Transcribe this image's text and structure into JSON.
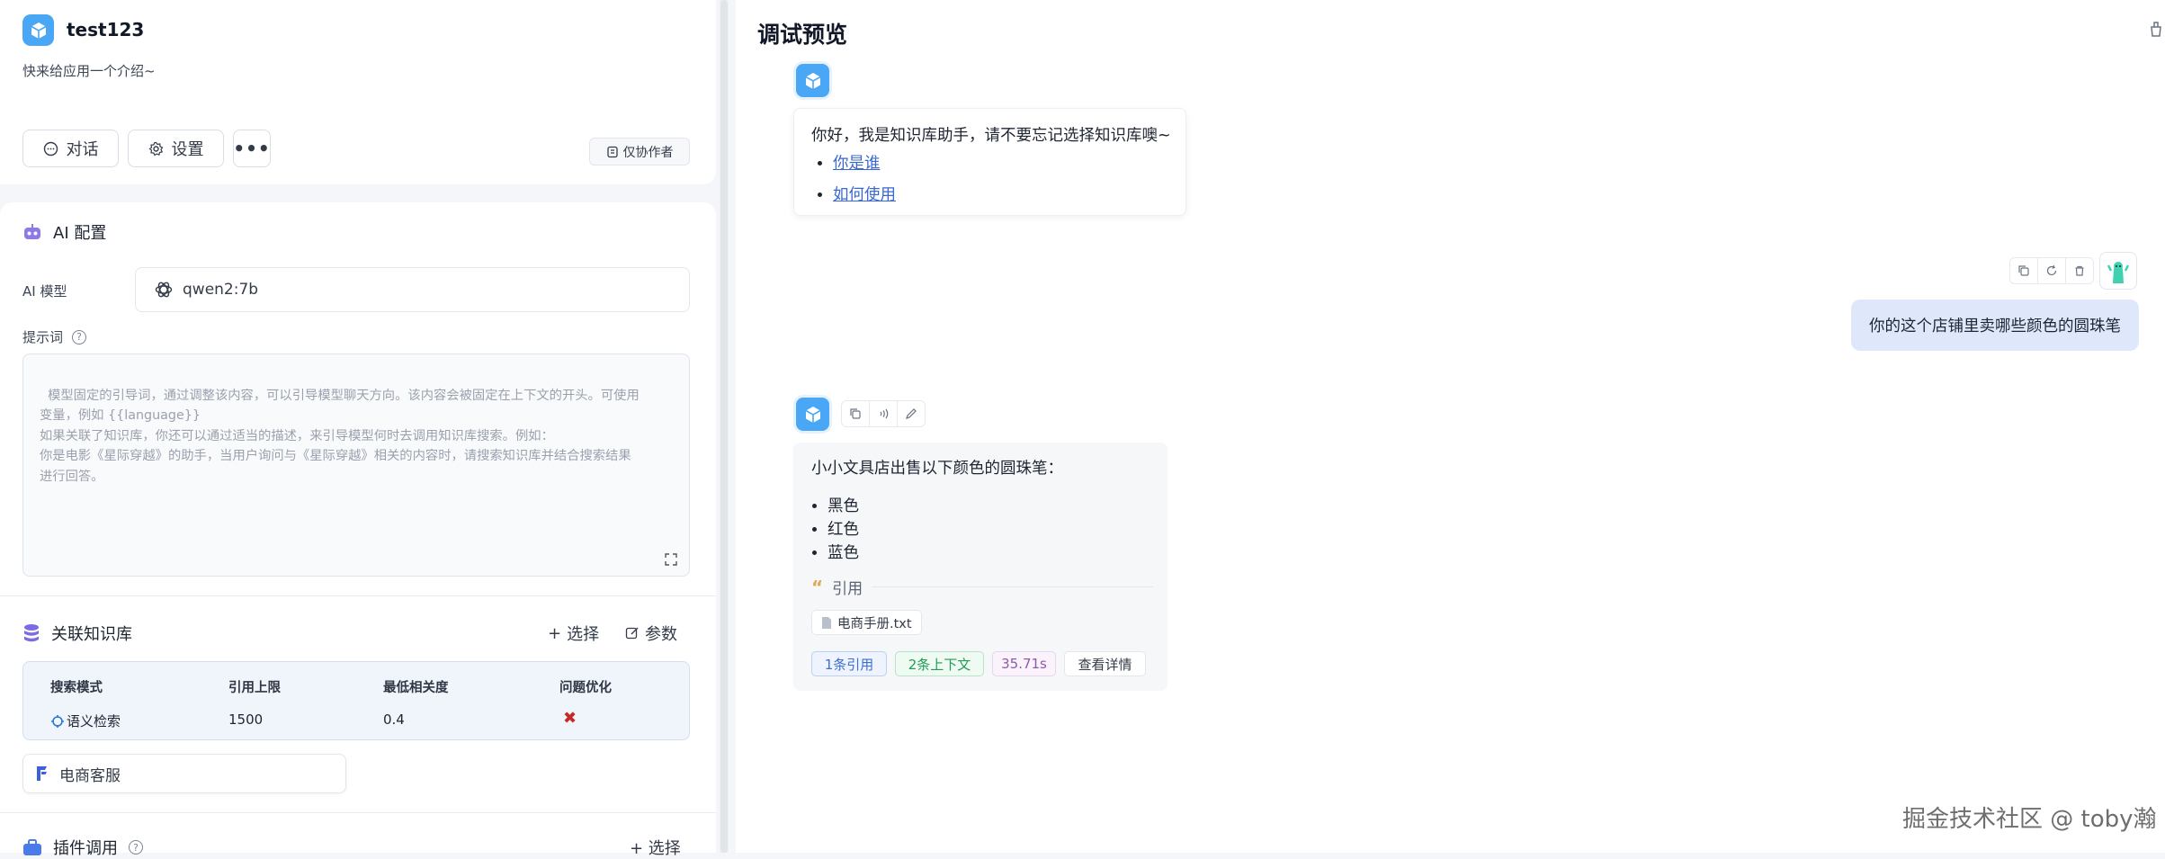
{
  "app": {
    "name": "test123",
    "intro": "快来给应用一个介绍~",
    "buttons": {
      "chat": "对话",
      "settings": "设置",
      "more": "•••"
    },
    "collab_badge": "仅协作者"
  },
  "ai_config": {
    "title": "AI 配置",
    "model_label": "AI 模型",
    "model_value": "qwen2:7b",
    "prompt_label": "提示词",
    "prompt_placeholder": "模型固定的引导词，通过调整该内容，可以引导模型聊天方向。该内容会被固定在上下文的开头。可使用\n变量，例如 {{language}}\n如果关联了知识库，你还可以通过适当的描述，来引导模型何时去调用知识库搜索。例如：\n你是电影《星际穿越》的助手，当用户询问与《星际穿越》相关的内容时，请搜索知识库并结合搜索结果\n进行回答。"
  },
  "knowledge": {
    "title": "关联知识库",
    "select_label": "选择",
    "param_label": "参数",
    "headers": [
      "搜索模式",
      "引用上限",
      "最低相关度",
      "问题优化"
    ],
    "row": {
      "mode": "语义检索",
      "limit": "1500",
      "similarity": "0.4",
      "optimize": "✖"
    },
    "dataset": "电商客服"
  },
  "plugins": {
    "title": "插件调用",
    "select_label": "+ 选择"
  },
  "preview": {
    "title": "调试预览",
    "welcome": "你好，我是知识库助手，请不要忘记选择知识库噢~",
    "welcome_links": [
      "你是谁",
      "如何使用"
    ],
    "user_question": "你的这个店铺里卖哪些颜色的圆珠笔",
    "answer_intro": "小小文具店出售以下颜色的圆珠笔：",
    "answer_items": [
      "黑色",
      "红色",
      "蓝色"
    ],
    "quote_label": "引用",
    "quote_file": "电商手册.txt",
    "tags": {
      "cite": "1条引用",
      "context": "2条上下文",
      "time": "35.71s",
      "detail": "查看详情"
    }
  },
  "watermark": "掘金技术社区 @ toby瀚",
  "colors": {
    "accent": "#4aa7f5",
    "link": "#3868d0",
    "user_bubble": "#dfe8fb"
  }
}
